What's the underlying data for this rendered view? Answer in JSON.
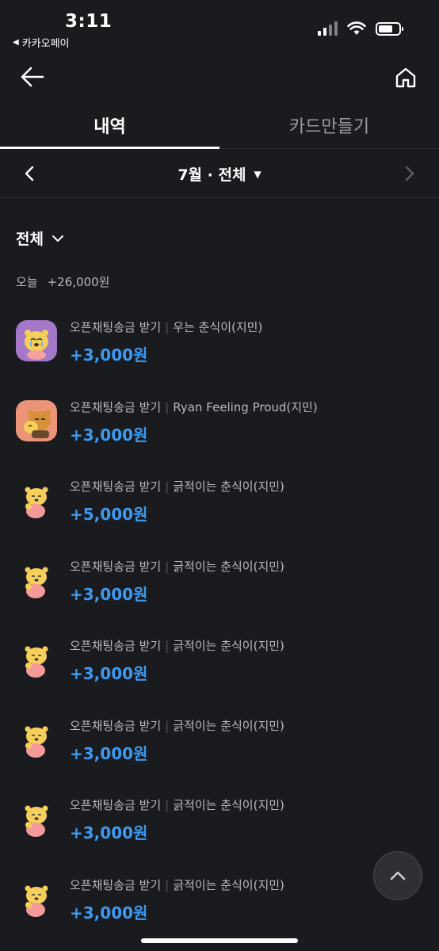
{
  "status_bar": {
    "time": "3:11",
    "back_app": "카카오페이"
  },
  "tabs": [
    {
      "label": "내역",
      "active": true
    },
    {
      "label": "카드만들기",
      "active": false
    }
  ],
  "month_selector": {
    "title": "7월 · 전체"
  },
  "filter": {
    "label": "전체"
  },
  "day_summary": {
    "day": "오늘",
    "total": "+26,000원"
  },
  "transactions": [
    {
      "title": "오픈채팅송금 받기",
      "detail": "우는 춘식이(지민)",
      "amount": "+3,000원",
      "avatar": "crying-chunsik"
    },
    {
      "title": "오픈채팅송금 받기",
      "detail": "Ryan Feeling Proud(지민)",
      "amount": "+3,000원",
      "avatar": "ryan-proud"
    },
    {
      "title": "오픈채팅송금 받기",
      "detail": "긁적이는 춘식이(지민)",
      "amount": "+5,000원",
      "avatar": "scratching-chunsik"
    },
    {
      "title": "오픈채팅송금 받기",
      "detail": "긁적이는 춘식이(지민)",
      "amount": "+3,000원",
      "avatar": "scratching-chunsik"
    },
    {
      "title": "오픈채팅송금 받기",
      "detail": "긁적이는 춘식이(지민)",
      "amount": "+3,000원",
      "avatar": "scratching-chunsik"
    },
    {
      "title": "오픈채팅송금 받기",
      "detail": "긁적이는 춘식이(지민)",
      "amount": "+3,000원",
      "avatar": "scratching-chunsik"
    },
    {
      "title": "오픈채팅송금 받기",
      "detail": "긁적이는 춘식이(지민)",
      "amount": "+3,000원",
      "avatar": "scratching-chunsik"
    },
    {
      "title": "오픈채팅송금 받기",
      "detail": "긁적이는 춘식이(지민)",
      "amount": "+3,000원",
      "avatar": "scratching-chunsik"
    }
  ],
  "colors": {
    "background": "#1a1b1f",
    "amount": "#3c9af1",
    "muted_text": "#b8b9bd"
  },
  "icons": {
    "nav_back": "arrow-left-icon",
    "nav_home": "home-icon",
    "scroll_top": "chevron-up-icon"
  }
}
